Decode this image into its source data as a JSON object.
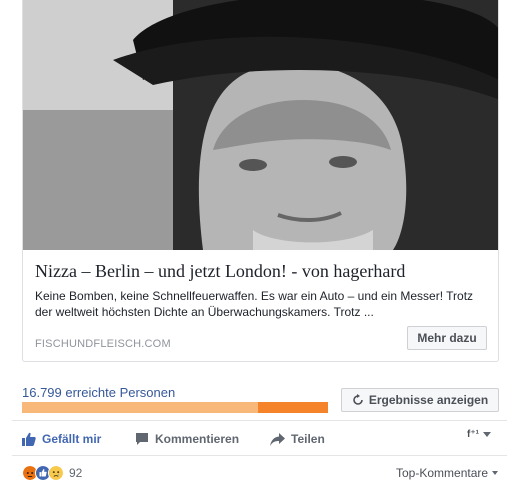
{
  "card": {
    "image_alt": "photo-man-in-hat",
    "title": "Nizza – Berlin – und jetzt London! - von hagerhard",
    "description": "Keine Bomben, keine Schnellfeuerwaffen. Es war ein Auto – und ein Messer! Trotz der weltweit höchsten Dichte an Überwachungskamers. Trotz ...",
    "domain": "FISCHUNDFLEISCH.COM",
    "more_label": "Mehr dazu"
  },
  "reach": {
    "text": "16.799 erreichte Personen",
    "results_label": "Ergebnisse anzeigen",
    "paid_fraction": 0.23,
    "colors": {
      "organic": "#f7b87a",
      "paid": "#f5832a"
    }
  },
  "actions": {
    "like_label": "Gefällt mir",
    "comment_label": "Kommentieren",
    "share_label": "Teilen",
    "actor_badge": "f⁺¹"
  },
  "reactions": {
    "icons": [
      "angry-icon",
      "like-icon",
      "sad-icon"
    ],
    "count": "92",
    "sort_label": "Top-Kommentare"
  },
  "colors": {
    "link": "#365899",
    "like_blue": "#4267b2",
    "text_grey": "#606770"
  }
}
